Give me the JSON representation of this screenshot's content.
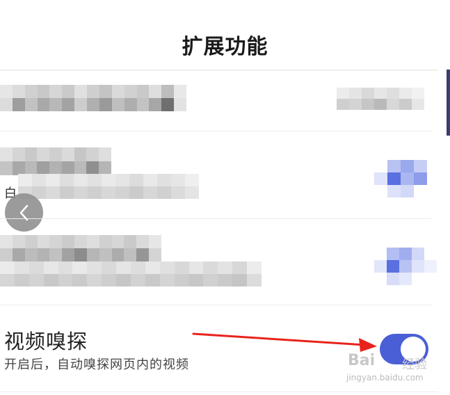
{
  "header": {
    "title": "扩展功能"
  },
  "colors": {
    "accent": "#4a5fd6",
    "arrow": "#e8231c",
    "pixel_light": "#e9e9e9",
    "pixel_mid": "#bdbdbd",
    "pixel_dark": "#8a8a8a",
    "pixel_blue": "#5a6fe0",
    "pixel_blue_light": "#dfe3fb"
  },
  "settings": {
    "obscured_row_partial_char": "白",
    "sniff_item": {
      "title": "视频嗅探",
      "description": "开启后，自动嗅探网页内的视频",
      "enabled": true
    }
  },
  "icons": {
    "back": "chevron-left-icon",
    "toggle": "toggle-switch-icon"
  },
  "watermark": {
    "brand_text": "Bai",
    "brand_suffix": "经验",
    "url": "jingyan.baidu.com"
  }
}
